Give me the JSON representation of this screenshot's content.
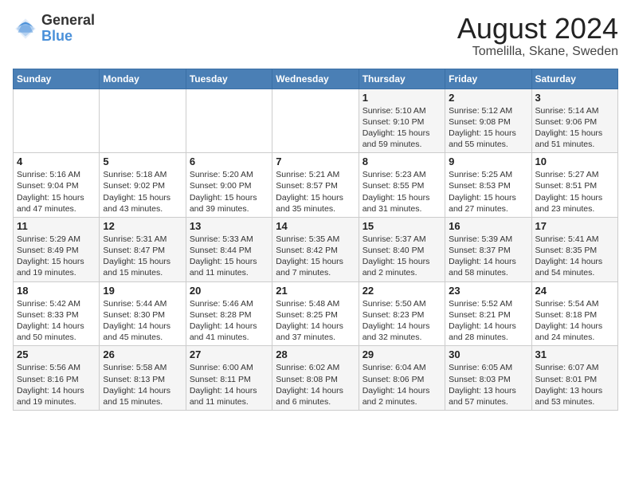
{
  "logo": {
    "general": "General",
    "blue": "Blue"
  },
  "title": "August 2024",
  "subtitle": "Tomelilla, Skane, Sweden",
  "weekdays": [
    "Sunday",
    "Monday",
    "Tuesday",
    "Wednesday",
    "Thursday",
    "Friday",
    "Saturday"
  ],
  "weeks": [
    [
      {
        "day": "",
        "info": ""
      },
      {
        "day": "",
        "info": ""
      },
      {
        "day": "",
        "info": ""
      },
      {
        "day": "",
        "info": ""
      },
      {
        "day": "1",
        "info": "Sunrise: 5:10 AM\nSunset: 9:10 PM\nDaylight: 15 hours\nand 59 minutes."
      },
      {
        "day": "2",
        "info": "Sunrise: 5:12 AM\nSunset: 9:08 PM\nDaylight: 15 hours\nand 55 minutes."
      },
      {
        "day": "3",
        "info": "Sunrise: 5:14 AM\nSunset: 9:06 PM\nDaylight: 15 hours\nand 51 minutes."
      }
    ],
    [
      {
        "day": "4",
        "info": "Sunrise: 5:16 AM\nSunset: 9:04 PM\nDaylight: 15 hours\nand 47 minutes."
      },
      {
        "day": "5",
        "info": "Sunrise: 5:18 AM\nSunset: 9:02 PM\nDaylight: 15 hours\nand 43 minutes."
      },
      {
        "day": "6",
        "info": "Sunrise: 5:20 AM\nSunset: 9:00 PM\nDaylight: 15 hours\nand 39 minutes."
      },
      {
        "day": "7",
        "info": "Sunrise: 5:21 AM\nSunset: 8:57 PM\nDaylight: 15 hours\nand 35 minutes."
      },
      {
        "day": "8",
        "info": "Sunrise: 5:23 AM\nSunset: 8:55 PM\nDaylight: 15 hours\nand 31 minutes."
      },
      {
        "day": "9",
        "info": "Sunrise: 5:25 AM\nSunset: 8:53 PM\nDaylight: 15 hours\nand 27 minutes."
      },
      {
        "day": "10",
        "info": "Sunrise: 5:27 AM\nSunset: 8:51 PM\nDaylight: 15 hours\nand 23 minutes."
      }
    ],
    [
      {
        "day": "11",
        "info": "Sunrise: 5:29 AM\nSunset: 8:49 PM\nDaylight: 15 hours\nand 19 minutes."
      },
      {
        "day": "12",
        "info": "Sunrise: 5:31 AM\nSunset: 8:47 PM\nDaylight: 15 hours\nand 15 minutes."
      },
      {
        "day": "13",
        "info": "Sunrise: 5:33 AM\nSunset: 8:44 PM\nDaylight: 15 hours\nand 11 minutes."
      },
      {
        "day": "14",
        "info": "Sunrise: 5:35 AM\nSunset: 8:42 PM\nDaylight: 15 hours\nand 7 minutes."
      },
      {
        "day": "15",
        "info": "Sunrise: 5:37 AM\nSunset: 8:40 PM\nDaylight: 15 hours\nand 2 minutes."
      },
      {
        "day": "16",
        "info": "Sunrise: 5:39 AM\nSunset: 8:37 PM\nDaylight: 14 hours\nand 58 minutes."
      },
      {
        "day": "17",
        "info": "Sunrise: 5:41 AM\nSunset: 8:35 PM\nDaylight: 14 hours\nand 54 minutes."
      }
    ],
    [
      {
        "day": "18",
        "info": "Sunrise: 5:42 AM\nSunset: 8:33 PM\nDaylight: 14 hours\nand 50 minutes."
      },
      {
        "day": "19",
        "info": "Sunrise: 5:44 AM\nSunset: 8:30 PM\nDaylight: 14 hours\nand 45 minutes."
      },
      {
        "day": "20",
        "info": "Sunrise: 5:46 AM\nSunset: 8:28 PM\nDaylight: 14 hours\nand 41 minutes."
      },
      {
        "day": "21",
        "info": "Sunrise: 5:48 AM\nSunset: 8:25 PM\nDaylight: 14 hours\nand 37 minutes."
      },
      {
        "day": "22",
        "info": "Sunrise: 5:50 AM\nSunset: 8:23 PM\nDaylight: 14 hours\nand 32 minutes."
      },
      {
        "day": "23",
        "info": "Sunrise: 5:52 AM\nSunset: 8:21 PM\nDaylight: 14 hours\nand 28 minutes."
      },
      {
        "day": "24",
        "info": "Sunrise: 5:54 AM\nSunset: 8:18 PM\nDaylight: 14 hours\nand 24 minutes."
      }
    ],
    [
      {
        "day": "25",
        "info": "Sunrise: 5:56 AM\nSunset: 8:16 PM\nDaylight: 14 hours\nand 19 minutes."
      },
      {
        "day": "26",
        "info": "Sunrise: 5:58 AM\nSunset: 8:13 PM\nDaylight: 14 hours\nand 15 minutes."
      },
      {
        "day": "27",
        "info": "Sunrise: 6:00 AM\nSunset: 8:11 PM\nDaylight: 14 hours\nand 11 minutes."
      },
      {
        "day": "28",
        "info": "Sunrise: 6:02 AM\nSunset: 8:08 PM\nDaylight: 14 hours\nand 6 minutes."
      },
      {
        "day": "29",
        "info": "Sunrise: 6:04 AM\nSunset: 8:06 PM\nDaylight: 14 hours\nand 2 minutes."
      },
      {
        "day": "30",
        "info": "Sunrise: 6:05 AM\nSunset: 8:03 PM\nDaylight: 13 hours\nand 57 minutes."
      },
      {
        "day": "31",
        "info": "Sunrise: 6:07 AM\nSunset: 8:01 PM\nDaylight: 13 hours\nand 53 minutes."
      }
    ]
  ]
}
